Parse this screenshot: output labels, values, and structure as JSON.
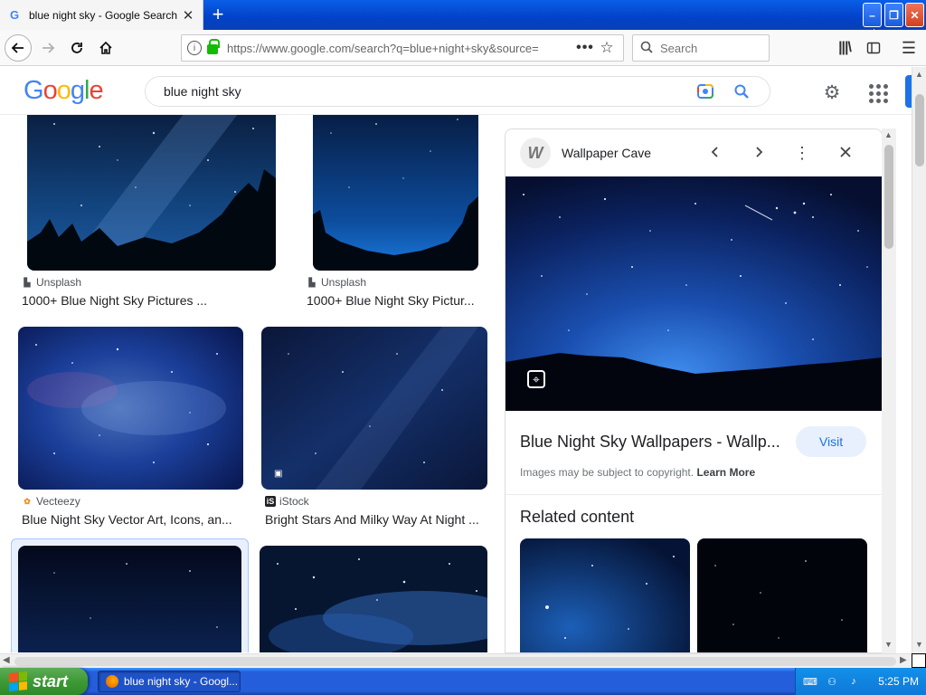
{
  "browser": {
    "tab_title": "blue night sky - Google Search",
    "tab_close": "✕",
    "new_tab": "+",
    "url": "https://www.google.com/search?q=blue+night+sky&source=",
    "page_actions": "•••",
    "bookmark_star": "☆",
    "search_placeholder": "Search",
    "window_controls": {
      "minimize": "–",
      "maximize": "❐",
      "close": "✕"
    }
  },
  "google": {
    "logo": [
      "G",
      "o",
      "o",
      "g",
      "l",
      "e"
    ],
    "query": "blue night sky"
  },
  "results": [
    {
      "source": "Unsplash",
      "title": "1000+ Blue Night Sky Pictures ..."
    },
    {
      "source": "Unsplash",
      "title": "1000+ Blue Night Sky Pictur..."
    },
    {
      "source": "Vecteezy",
      "title": "Blue Night Sky Vector Art, Icons, an..."
    },
    {
      "source": "iStock",
      "title": "Bright Stars And Milky Way At Night ..."
    }
  ],
  "panel": {
    "site_name": "Wallpaper Cave",
    "site_logo": "W",
    "title": "Blue Night Sky Wallpapers - Wallp...",
    "visit_label": "Visit",
    "copyright_text": "Images may be subject to copyright.",
    "learn_more": "Learn More",
    "related_heading": "Related content"
  },
  "taskbar": {
    "start_label": "start",
    "task_label": "blue night sky - Googl...",
    "clock": "5:25 PM"
  },
  "colors": {
    "google_blue": "#4285f4",
    "google_red": "#ea4335",
    "google_yellow": "#fbbc05",
    "google_green": "#34a853",
    "visit_text": "#1a73e8",
    "xp_taskbar": "#245edb",
    "xp_start": "#3c9a34"
  }
}
